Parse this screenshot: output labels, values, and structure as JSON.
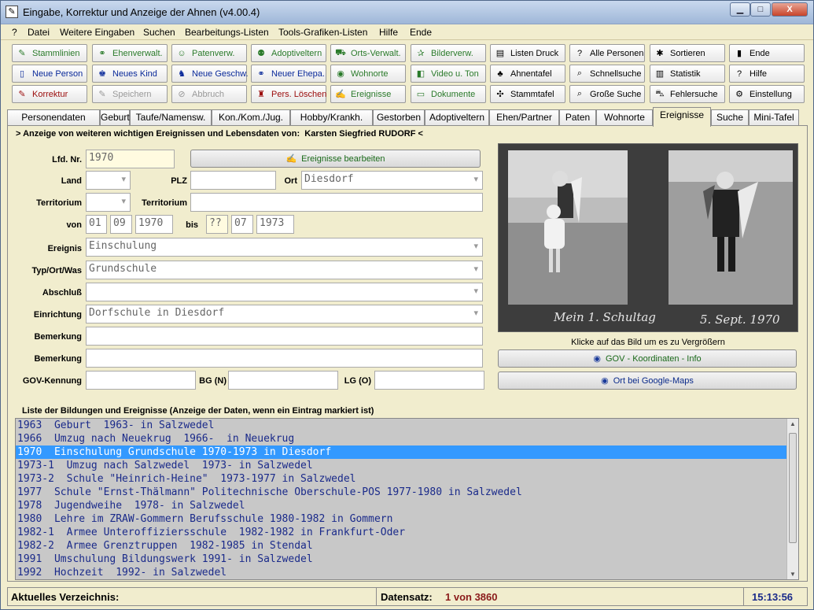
{
  "window": {
    "title": "Eingabe, Korrektur und Anzeige der Ahnen (v4.00.4)",
    "min": "▁",
    "max": "□",
    "close": "X"
  },
  "menu": [
    "?",
    "Datei",
    "Weitere Eingaben",
    "Suchen",
    "Bearbeitungs-Listen",
    "Tools-Grafiken-Listen",
    "Hilfe",
    "Ende"
  ],
  "toolbar": [
    {
      "label": "Stammlinien",
      "icon": "tree-icon",
      "glyph": "✎",
      "color": "#2a7a2a",
      "dis": false
    },
    {
      "label": "Ehenverwalt.",
      "icon": "ring-icon",
      "glyph": "⚭",
      "color": "#2a7a2a",
      "dis": false
    },
    {
      "label": "Patenverw.",
      "icon": "face-icon",
      "glyph": "☺",
      "color": "#2a7a2a",
      "dis": false
    },
    {
      "label": "Adoptiveltern",
      "icon": "people-icon",
      "glyph": "⚉",
      "color": "#2a7a2a",
      "dis": false
    },
    {
      "label": "Orts-Verwalt.",
      "icon": "car-icon",
      "glyph": "⛟",
      "color": "#2a7a2a",
      "dis": false
    },
    {
      "label": "Bilderverw.",
      "icon": "running-icon",
      "glyph": "✰",
      "color": "#2a7a2a",
      "dis": false
    },
    {
      "label": "Listen Druck",
      "icon": "list-print-icon",
      "glyph": "▤",
      "color": "#000",
      "dis": false
    },
    {
      "label": "Alle Personen",
      "icon": "question-all-icon",
      "glyph": "?",
      "color": "#000",
      "dis": false
    },
    {
      "label": "Sortieren",
      "icon": "sort-icon",
      "glyph": "✱",
      "color": "#000",
      "dis": false
    },
    {
      "label": "Ende",
      "icon": "exit-icon",
      "glyph": "▮",
      "color": "#000",
      "dis": false
    },
    {
      "label": "Neue Person",
      "icon": "new-page-icon",
      "glyph": "▯",
      "color": "#0a2a9a",
      "dis": false
    },
    {
      "label": "Neues Kind",
      "icon": "child-icon",
      "glyph": "♚",
      "color": "#0a2a9a",
      "dis": false
    },
    {
      "label": "Neue Geschw.",
      "icon": "siblings-icon",
      "glyph": "♞",
      "color": "#0a2a9a",
      "dis": false
    },
    {
      "label": "Neuer Ehepa.",
      "icon": "couple-ring-icon",
      "glyph": "⚭",
      "color": "#0a2a9a",
      "dis": false
    },
    {
      "label": "Wohnorte",
      "icon": "globe-icon",
      "glyph": "◉",
      "color": "#2a7a2a",
      "dis": false
    },
    {
      "label": "Video u. Ton",
      "icon": "camera-icon",
      "glyph": "◧",
      "color": "#2a7a2a",
      "dis": false
    },
    {
      "label": "Ahnentafel",
      "icon": "chart-tree-icon",
      "glyph": "♣",
      "color": "#000",
      "dis": false
    },
    {
      "label": "Schnellsuche",
      "icon": "search-doc-icon",
      "glyph": "⌕",
      "color": "#000",
      "dis": false
    },
    {
      "label": "Statistik",
      "icon": "stats-icon",
      "glyph": "▥",
      "color": "#000",
      "dis": false
    },
    {
      "label": "Hilfe",
      "icon": "help-icon",
      "glyph": "?",
      "color": "#000",
      "dis": false
    },
    {
      "label": "Korrektur",
      "icon": "edit-icon",
      "glyph": "✎",
      "color": "#9a0a0a",
      "dis": false
    },
    {
      "label": "Speichern",
      "icon": "save-icon",
      "glyph": "✎",
      "color": "#999",
      "dis": true
    },
    {
      "label": "Abbruch",
      "icon": "cancel-icon",
      "glyph": "⊘",
      "color": "#999",
      "dis": true
    },
    {
      "label": "Pers. Löschen",
      "icon": "trash-icon",
      "glyph": "♜",
      "color": "#9a0a0a",
      "dis": false
    },
    {
      "label": "Ereignisse",
      "icon": "quill-icon",
      "glyph": "✍",
      "color": "#2a7a2a",
      "dis": false
    },
    {
      "label": "Dokumente",
      "icon": "document-icon",
      "glyph": "▭",
      "color": "#2a7a2a",
      "dis": false
    },
    {
      "label": "Stammtafel",
      "icon": "family-tree-icon",
      "glyph": "✣",
      "color": "#000",
      "dis": false
    },
    {
      "label": "Große Suche",
      "icon": "big-search-icon",
      "glyph": "⌕",
      "color": "#000",
      "dis": false
    },
    {
      "label": "Fehlersuche",
      "icon": "bug-icon",
      "glyph": "⛍",
      "color": "#000",
      "dis": false
    },
    {
      "label": "Einstellung",
      "icon": "settings-icon",
      "glyph": "⚙",
      "color": "#000",
      "dis": false
    }
  ],
  "tabs": [
    "Personendaten",
    "Geburt",
    "Taufe/Namensw.",
    "Kon./Kom./Jug.",
    "Hobby/Krankh.",
    "Gestorben",
    "Adoptiveltern",
    "Ehen/Partner",
    "Paten",
    "Wohnorte",
    "Ereignisse",
    "Suche",
    "Mini-Tafel"
  ],
  "form": {
    "heading_prefix": "> Anzeige von weiteren wichtigen Ereignissen und Lebensdaten von:",
    "heading_name": "Karsten Siegfried RUDORF <",
    "lfd_label": "Lfd. Nr.",
    "lfd_value": "1970",
    "edit_button": "Ereignisse bearbeiten",
    "land_label": "Land",
    "land_value": "",
    "plz_label": "PLZ",
    "plz_value": "",
    "ort_label": "Ort",
    "ort_value": "Diesdorf",
    "territorium_label": "Territorium",
    "territorium_value": "",
    "territorium2_label": "Territorium",
    "territorium2_value": "",
    "von_label": "von",
    "von_day": "01",
    "von_month": "09",
    "von_year": "1970",
    "bis_label": "bis",
    "bis_day": "??",
    "bis_month": "07",
    "bis_year": "1973",
    "ereignis_label": "Ereignis",
    "ereignis_value": "Einschulung",
    "typ_label": "Typ/Ort/Was",
    "typ_value": "Grundschule",
    "abschluss_label": "Abschluß",
    "abschluss_value": "",
    "einrichtung_label": "Einrichtung",
    "einrichtung_value": "Dorfschule in Diesdorf",
    "bemerkung1_label": "Bemerkung",
    "bemerkung1_value": "",
    "bemerkung2_label": "Bemerkung",
    "bemerkung2_value": "",
    "gov_label": "GOV-Kennung",
    "gov_value": "",
    "bg_label": "BG (N)",
    "bg_value": "",
    "lg_label": "LG (O)",
    "lg_value": ""
  },
  "photo": {
    "caption_left": "Mein 1. Schultag",
    "caption_right": "5. Sept. 1970",
    "hint": "Klicke auf das Bild um es zu Vergrößern"
  },
  "side_buttons": {
    "gov": "GOV - Koordinaten - Info",
    "maps": "Ort bei Google-Maps"
  },
  "list": {
    "heading": "Liste der Bildungen und Ereignisse (Anzeige der Daten, wenn ein Eintrag markiert ist)",
    "selected_index": 2,
    "rows": [
      "1963  Geburt  1963- in Salzwedel",
      "1966  Umzug nach Neuekrug  1966-  in Neuekrug",
      "1970  Einschulung Grundschule 1970-1973 in Diesdorf",
      "1973-1  Umzug nach Salzwedel  1973- in Salzwedel",
      "1973-2  Schule \"Heinrich-Heine\"  1973-1977 in Salzwedel",
      "1977  Schule \"Ernst-Thälmann\" Politechnische Oberschule-POS 1977-1980 in Salzwedel",
      "1978  Jugendweihe  1978- in Salzwedel",
      "1980  Lehre im ZRAW-Gommern Berufsschule 1980-1982 in Gommern",
      "1982-1  Armee Unteroffiziersschule  1982-1982 in Frankfurt-Oder",
      "1982-2  Armee Grenztruppen  1982-1985 in Stendal",
      "1991  Umschulung Bildungswerk 1991- in Salzwedel",
      "1992  Hochzeit  1992- in Salzwedel"
    ]
  },
  "status": {
    "dir_label": "Aktuelles Verzeichnis:",
    "dir_value": "",
    "record_label": "Datensatz:",
    "record_value": "1 von 3860",
    "time": "15:13:56"
  }
}
